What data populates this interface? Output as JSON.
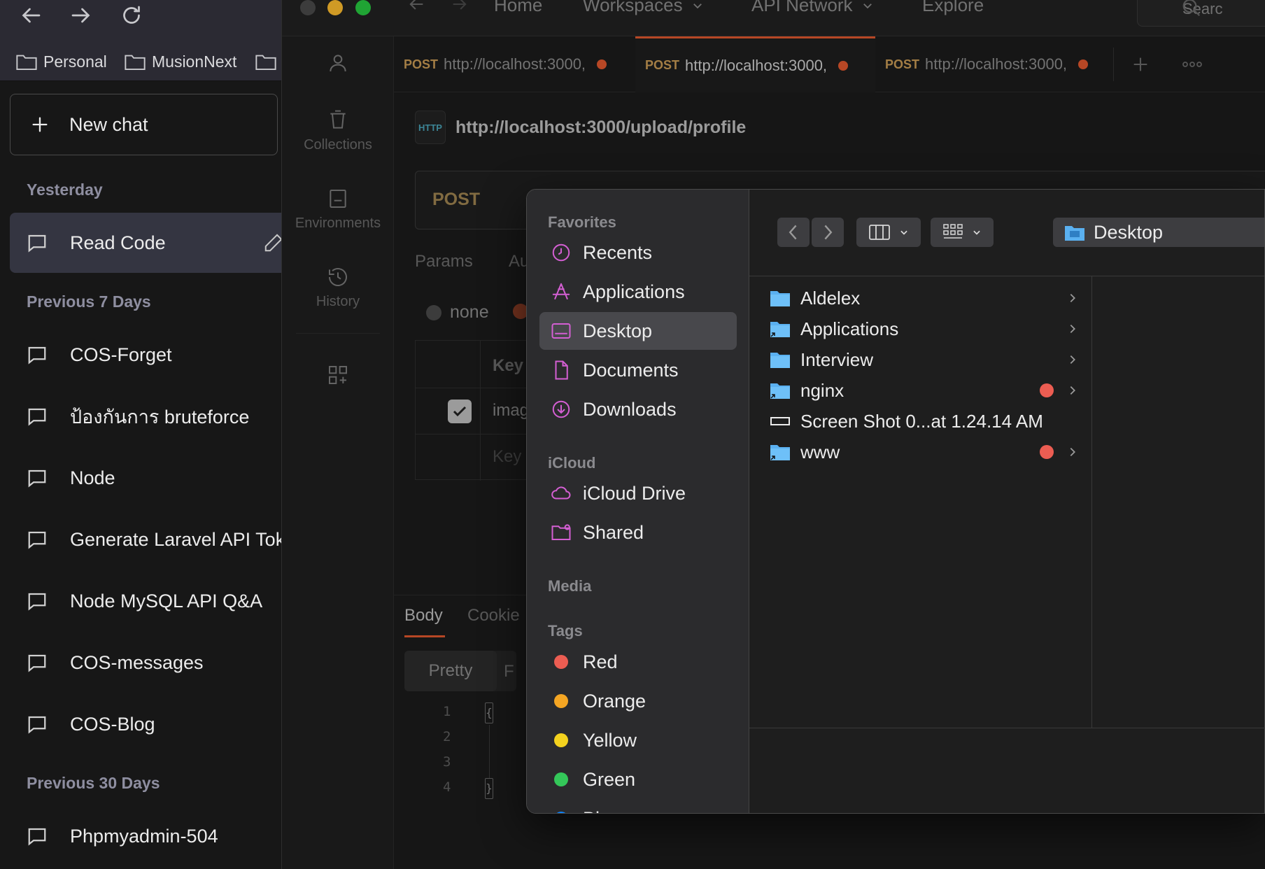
{
  "browser": {
    "bookmarks": [
      "Personal",
      "MusionNext"
    ]
  },
  "sidebar": {
    "new_chat_label": "New chat",
    "sections": [
      {
        "label": "Yesterday"
      },
      {
        "label": "Previous 7 Days"
      },
      {
        "label": "Previous 30 Days"
      }
    ],
    "chats": [
      {
        "title": "Read Code",
        "active": true
      },
      {
        "title": "COS-Forget"
      },
      {
        "title": "ป้องกันการ bruteforce"
      },
      {
        "title": "Node"
      },
      {
        "title": "Generate Laravel API Tok"
      },
      {
        "title": "Node MySQL API Q&A"
      },
      {
        "title": "COS-messages"
      },
      {
        "title": "COS-Blog"
      },
      {
        "title": "Phpmyadmin-504"
      }
    ]
  },
  "postman": {
    "nav": {
      "home": "Home",
      "workspaces": "Workspaces",
      "api_network": "API Network",
      "explore": "Explore",
      "search": "Searc"
    },
    "rail": {
      "collections": "Collections",
      "environments": "Environments",
      "history": "History"
    },
    "tabs": [
      {
        "method": "POST",
        "url": "http://localhost:3000,"
      },
      {
        "method": "POST",
        "url": "http://localhost:3000,"
      },
      {
        "method": "POST",
        "url": "http://localhost:3000,"
      }
    ],
    "http_badge": "HTTP",
    "url": "http://localhost:3000/upload/profile",
    "method": "POST",
    "request_tabs": {
      "params": "Params",
      "auth": "Au"
    },
    "body_mode": "none",
    "kv_table": {
      "key_header": "Key",
      "row_key": "imag",
      "placeholder": "Key"
    },
    "response_tabs": {
      "body": "Body",
      "cookies": "Cookie"
    },
    "pretty": "Pretty",
    "pretty_next": "F",
    "line_numbers": [
      "1",
      "2",
      "3",
      "4"
    ],
    "braces": [
      "{",
      "}"
    ]
  },
  "picker": {
    "favorites_label": "Favorites",
    "favorites": [
      {
        "label": "Recents",
        "icon": "clock-icon"
      },
      {
        "label": "Applications",
        "icon": "applications-icon"
      },
      {
        "label": "Desktop",
        "icon": "desktop-icon",
        "active": true
      },
      {
        "label": "Documents",
        "icon": "document-icon"
      },
      {
        "label": "Downloads",
        "icon": "download-icon"
      }
    ],
    "icloud_label": "iCloud",
    "icloud": [
      {
        "label": "iCloud Drive",
        "icon": "cloud-icon"
      },
      {
        "label": "Shared",
        "icon": "shared-folder-icon"
      }
    ],
    "media_label": "Media",
    "tags_label": "Tags",
    "tags": [
      {
        "label": "Red",
        "color": "#ec5d52"
      },
      {
        "label": "Orange",
        "color": "#f5a623"
      },
      {
        "label": "Yellow",
        "color": "#f4d21e"
      },
      {
        "label": "Green",
        "color": "#34c759"
      },
      {
        "label": "Blue",
        "color": "#0a84ff"
      }
    ],
    "location": "Desktop",
    "files": [
      {
        "name": "Aldelex",
        "kind": "folder",
        "tag": false,
        "chevron": true
      },
      {
        "name": "Applications",
        "kind": "alias-folder",
        "tag": false,
        "chevron": true
      },
      {
        "name": "Interview",
        "kind": "folder",
        "tag": false,
        "chevron": true
      },
      {
        "name": "nginx",
        "kind": "alias-folder",
        "tag": true,
        "chevron": true
      },
      {
        "name": "Screen Shot 0...at 1.24.14 AM",
        "kind": "screenshot",
        "tag": false,
        "chevron": false
      },
      {
        "name": "www",
        "kind": "alias-folder",
        "tag": true,
        "chevron": true
      }
    ]
  },
  "colors": {
    "accent": "#e0572e",
    "picker_icon": "#d45fd3",
    "folder_blue": "#5ab0f0"
  }
}
